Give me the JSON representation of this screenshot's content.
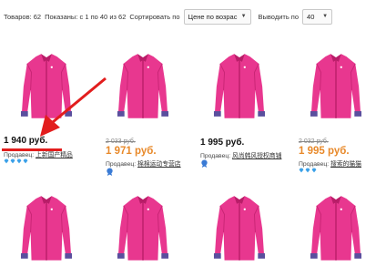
{
  "toolbar": {
    "total": "Товаров: 62",
    "shown": "Показаны: с 1 по 40 из 62",
    "sort_label": "Сортировать по",
    "sort_value": "Цене по возрас",
    "perpage_label": "Выводить по",
    "perpage_value": "40"
  },
  "products": [
    {
      "price": "1 940 руб.",
      "seller_prefix": "Продавец: ",
      "seller_name": "上新国产精品"
    },
    {
      "old_price": "2 033 руб.",
      "new_price": "1 971 руб.",
      "seller_prefix": "Продавец: ",
      "seller_name": "棉棉运动专营店"
    },
    {
      "price": "1 995 руб.",
      "seller_prefix": "Продавец: ",
      "seller_name": "风尚韩风授权商铺"
    },
    {
      "old_price": "2 032 руб.",
      "new_price": "1 995 руб.",
      "seller_prefix": "Продавец: ",
      "seller_name": "搜索的猫猫"
    }
  ],
  "colors": {
    "jacket": "#e8378f",
    "jacket_shade": "#b81d68",
    "cuff": "#5a4f9e",
    "accent_price": "#e8892a",
    "highlight": "#e21d1d",
    "gem": "#3aa0e8"
  },
  "icons": [
    "chevron-down-icon",
    "diamond-icon",
    "medal-icon",
    "arrow-annotation"
  ]
}
